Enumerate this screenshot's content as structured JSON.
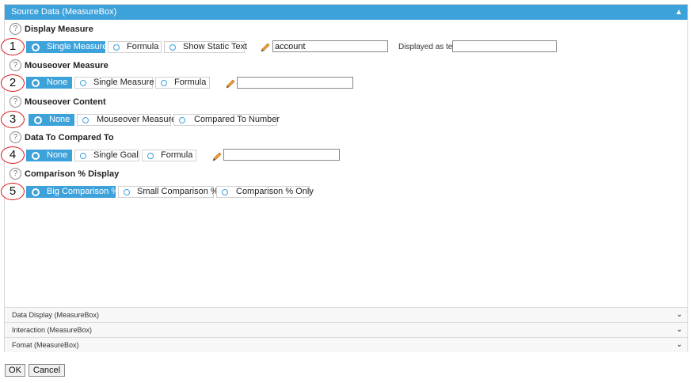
{
  "panel": {
    "title": "Source Data (MeasureBox)"
  },
  "sections": [
    {
      "number": "1",
      "label": "Display Measure",
      "options": [
        "Single Measure",
        "Formula",
        "Show Static Text"
      ],
      "selected": "Single Measure",
      "input_value": "account",
      "text_label": "Displayed as text:",
      "text_value": ""
    },
    {
      "number": "2",
      "label": "Mouseover Measure",
      "options": [
        "None",
        "Single Measure",
        "Formula"
      ],
      "selected": "None",
      "input_value": ""
    },
    {
      "number": "3",
      "label": "Mouseover Content",
      "options": [
        "None",
        "Mouseover Measure",
        "Compared To Number"
      ],
      "selected": "None"
    },
    {
      "number": "4",
      "label": "Data To Compared To",
      "options": [
        "None",
        "Single Goal",
        "Formula"
      ],
      "selected": "None",
      "input_value": ""
    },
    {
      "number": "5",
      "label": "Comparison % Display",
      "options": [
        "Big Comparison %",
        "Small Comparison %",
        "Comparison % Only"
      ],
      "selected": "Big Comparison %"
    }
  ],
  "accordions": [
    "Data Display (MeasureBox)",
    "Interaction (MeasureBox)",
    "Fomat (MeasureBox)"
  ],
  "buttons": {
    "ok": "OK",
    "cancel": "Cancel"
  },
  "colors": {
    "accent": "#3ea2da",
    "marker": "#dd1111"
  },
  "icons": {
    "help": "question-circle-icon",
    "edit": "pencil-icon",
    "expand": "chevron-icon"
  }
}
